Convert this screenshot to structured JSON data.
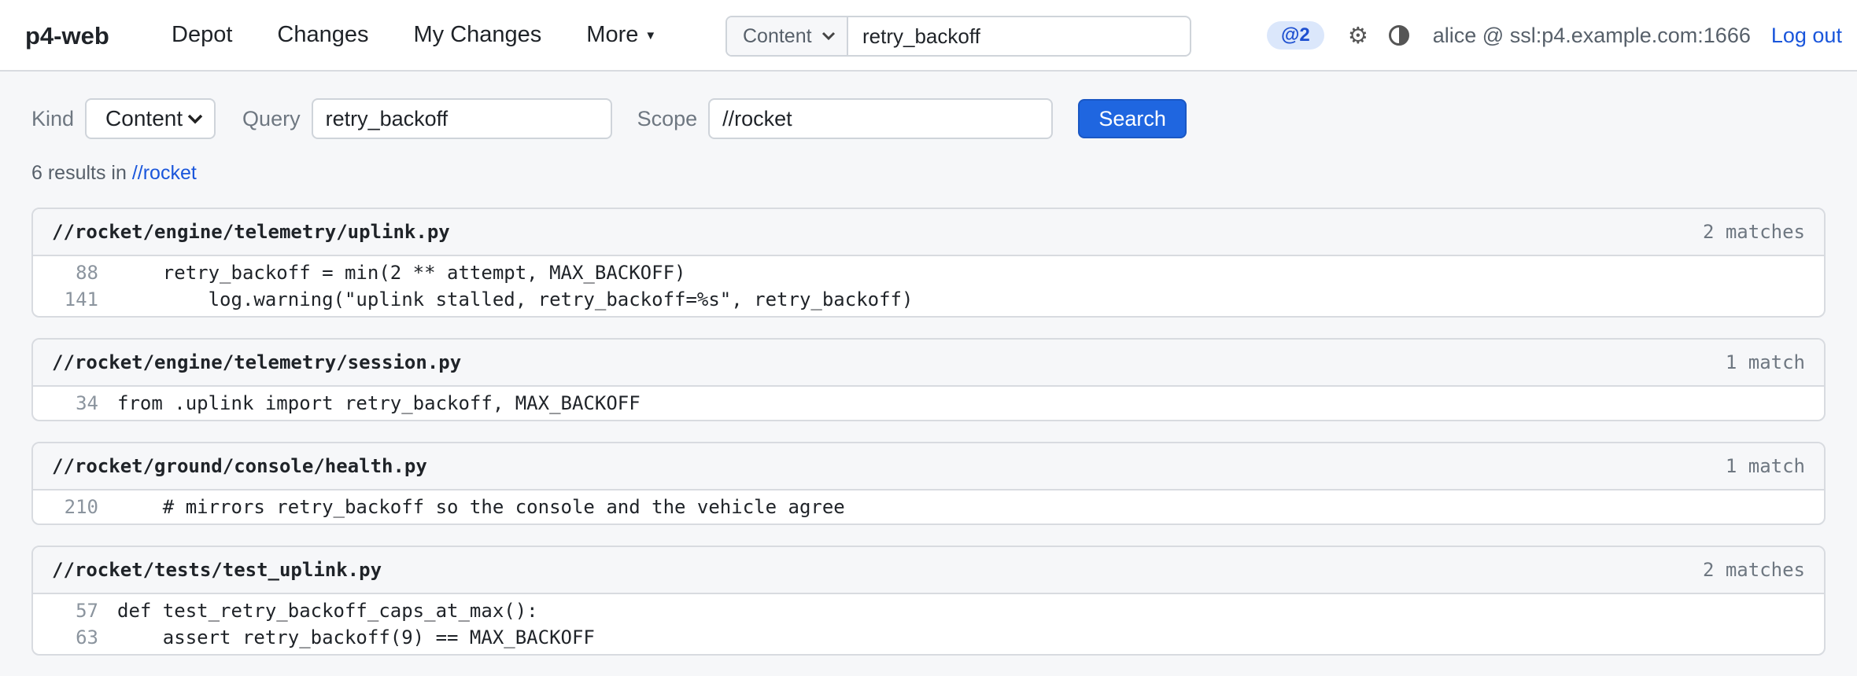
{
  "header": {
    "brand": "p4-web",
    "nav": [
      {
        "label": "Depot"
      },
      {
        "label": "Changes"
      },
      {
        "label": "My Changes"
      },
      {
        "label": "More"
      }
    ],
    "more_caret": "▼",
    "search": {
      "kind": "Content",
      "query": "retry_backoff"
    },
    "badge": "@2",
    "user": "alice @ ssl:p4.example.com:1666",
    "logout": "Log out"
  },
  "search_form": {
    "kind_label": "Kind",
    "kind_value": "Content",
    "query_label": "Query",
    "query_value": "retry_backoff",
    "scope_label": "Scope",
    "scope_value": "//rocket",
    "button": "Search"
  },
  "summary": {
    "text": "6 results in ",
    "scope_link": "//rocket"
  },
  "results": [
    {
      "path": "//rocket/engine/telemetry/uplink.py",
      "count": "2 matches",
      "lines": [
        {
          "no": "88",
          "code": "    retry_backoff = min(2 ** attempt, MAX_BACKOFF)"
        },
        {
          "no": "141",
          "code": "        log.warning(\"uplink stalled, retry_backoff=%s\", retry_backoff)"
        }
      ]
    },
    {
      "path": "//rocket/engine/telemetry/session.py",
      "count": "1 match",
      "lines": [
        {
          "no": "34",
          "code": "from .uplink import retry_backoff, MAX_BACKOFF"
        }
      ]
    },
    {
      "path": "//rocket/ground/console/health.py",
      "count": "1 match",
      "lines": [
        {
          "no": "210",
          "code": "    # mirrors retry_backoff so the console and the vehicle agree"
        }
      ]
    },
    {
      "path": "//rocket/tests/test_uplink.py",
      "count": "2 matches",
      "lines": [
        {
          "no": "57",
          "code": "def test_retry_backoff_caps_at_max():"
        },
        {
          "no": "63",
          "code": "    assert retry_backoff(9) == MAX_BACKOFF"
        }
      ]
    }
  ]
}
